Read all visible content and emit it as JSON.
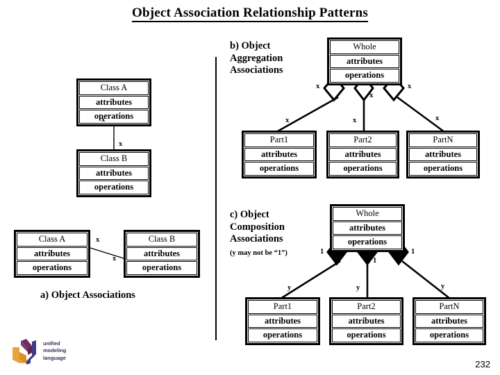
{
  "slide": {
    "title": "Object Association Relationship Patterns",
    "page_number": "232"
  },
  "logo": {
    "name": "uml-logo",
    "line1": "unified",
    "line2": "modeling",
    "line3": "language",
    "colors": {
      "u_yellow": "#E8A33D",
      "m_purple": "#6B2E5F",
      "l_blue": "#3B3A8C",
      "text": "#3D2B56"
    }
  },
  "section_a": {
    "caption": "a) Object Associations",
    "class_a": {
      "name": "Class A",
      "attributes": "attributes",
      "operations": "operations"
    },
    "class_b": {
      "name": "Class B",
      "attributes": "attributes",
      "operations": "operations"
    },
    "vertical_pair": {
      "class_a": {
        "name": "Class A",
        "attributes": "attributes",
        "operations": "operations"
      },
      "class_b": {
        "name": "Class B",
        "attributes": "attributes",
        "operations": "operations"
      },
      "mult_top": "x",
      "mult_bottom": "x"
    },
    "horizontal_pair": {
      "mult_left": "x",
      "mult_right": "x"
    }
  },
  "section_b": {
    "caption": "b) Object\nAggregation\nAssociations",
    "whole": {
      "name": "Whole",
      "attributes": "attributes",
      "operations": "operations"
    },
    "parts": [
      {
        "name": "Part1",
        "attributes": "attributes",
        "operations": "operations"
      },
      {
        "name": "Part2",
        "attributes": "attributes",
        "operations": "operations"
      },
      {
        "name": "PartN",
        "attributes": "attributes",
        "operations": "operations"
      }
    ],
    "diamond_style": "hollow",
    "mult_whole_side": [
      "x",
      "x",
      "x"
    ],
    "mult_part_side": [
      "x",
      "x",
      "x"
    ]
  },
  "section_c": {
    "caption": "c) Object\nComposition\nAssociations",
    "note": "(y may not be “1”)",
    "whole": {
      "name": "Whole",
      "attributes": "attributes",
      "operations": "operations"
    },
    "parts": [
      {
        "name": "Part1",
        "attributes": "attributes",
        "operations": "operations"
      },
      {
        "name": "Part2",
        "attributes": "attributes",
        "operations": "operations"
      },
      {
        "name": "PartN",
        "attributes": "attributes",
        "operations": "operations"
      }
    ],
    "diamond_style": "filled",
    "mult_whole_side": [
      "1",
      "1",
      "1"
    ],
    "mult_part_side": [
      "y",
      "y",
      "y"
    ]
  }
}
